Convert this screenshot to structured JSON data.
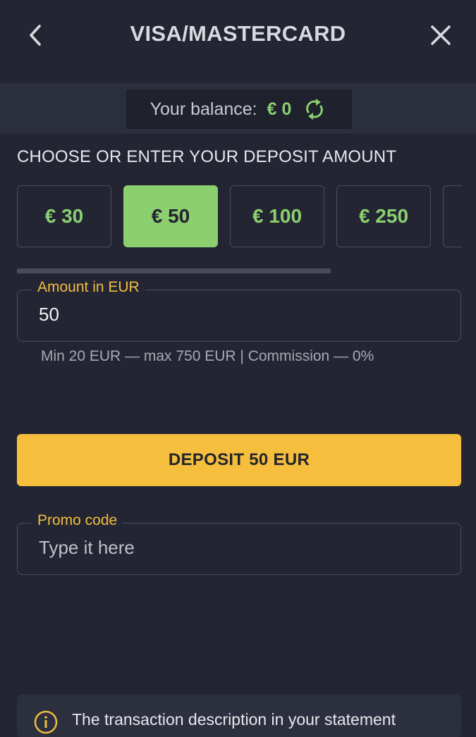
{
  "header": {
    "title": "VISA/MASTERCARD",
    "back_icon": "chevron-left-icon",
    "close_icon": "close-icon"
  },
  "balance": {
    "label": "Your balance:",
    "value": "€ 0",
    "refresh_icon": "refresh-icon"
  },
  "deposit": {
    "section_title": "CHOOSE OR ENTER YOUR DEPOSIT AMOUNT",
    "chips": [
      "€ 30",
      "€ 50",
      "€ 100",
      "€ 250"
    ],
    "selected_chip": "€ 50",
    "amount_label": "Amount in EUR",
    "amount_value": "50",
    "hint": "Min 20 EUR — max 750 EUR | Commission — 0%",
    "button_label": "DEPOSIT 50 EUR"
  },
  "promo": {
    "label": "Promo code",
    "placeholder": "Type it here"
  },
  "notice": {
    "icon": "info-icon",
    "text": "The transaction description in your statement"
  },
  "colors": {
    "background": "#232533",
    "accent_green": "#8bcf6f",
    "accent_yellow": "#f5bf3d",
    "label_yellow": "#f2bd3f"
  }
}
